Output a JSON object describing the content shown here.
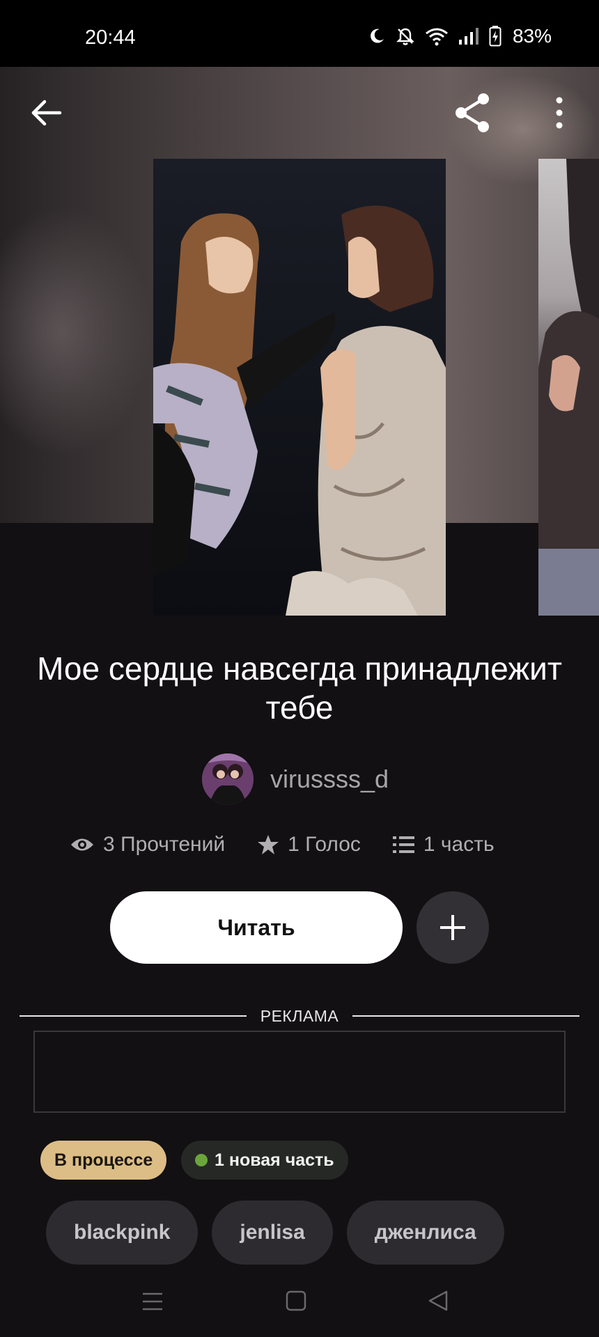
{
  "status_bar": {
    "time": "20:44",
    "battery": "83%",
    "icons": [
      "moon-icon",
      "bell-off-icon",
      "wifi-icon",
      "signal-icon",
      "battery-icon"
    ]
  },
  "top_nav": {
    "icons": [
      "back-arrow-icon",
      "share-icon",
      "more-vertical-icon"
    ]
  },
  "story": {
    "title": "Мое сердце навсегда принадлежит тебе",
    "author": "virussss_d",
    "stats": {
      "reads": "3 Прочтений",
      "votes": "1 Голос",
      "parts": "1 часть"
    }
  },
  "actions": {
    "read_label": "Читать",
    "add_icon": "plus-icon"
  },
  "ad": {
    "label": "РЕКЛАМА"
  },
  "badges": {
    "status": "В процессе",
    "new_part": "1 новая часть"
  },
  "tags": [
    "blackpink",
    "jenlisa",
    "дженлиса"
  ],
  "colors": {
    "background": "#121013",
    "status_badge": "#dcbd85",
    "new_dot": "#6aa53c",
    "tag_bg": "#2d2b2f"
  }
}
